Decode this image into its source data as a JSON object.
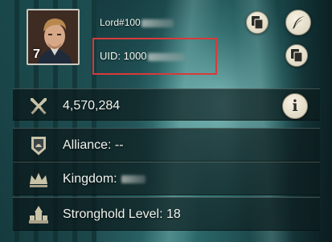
{
  "player": {
    "name_prefix": "Lord#100",
    "level": "7",
    "uid_prefix": "UID: 1000"
  },
  "stats": {
    "power": "4,570,284",
    "alliance": "Alliance: --",
    "kingdom": "Kingdom:",
    "stronghold": "Stronghold Level: 18"
  },
  "icons": {
    "copy_name": "copy-icon",
    "rename": "quill-icon",
    "copy_uid": "copy-icon",
    "power": "crossed-swords-icon",
    "alliance": "alliance-emblem-icon",
    "kingdom": "crown-icon",
    "stronghold": "castle-icon",
    "info": "info-icon"
  },
  "info_label": "i",
  "colors": {
    "highlight_box": "#d83a3a",
    "button_face": "#efe8d4"
  }
}
